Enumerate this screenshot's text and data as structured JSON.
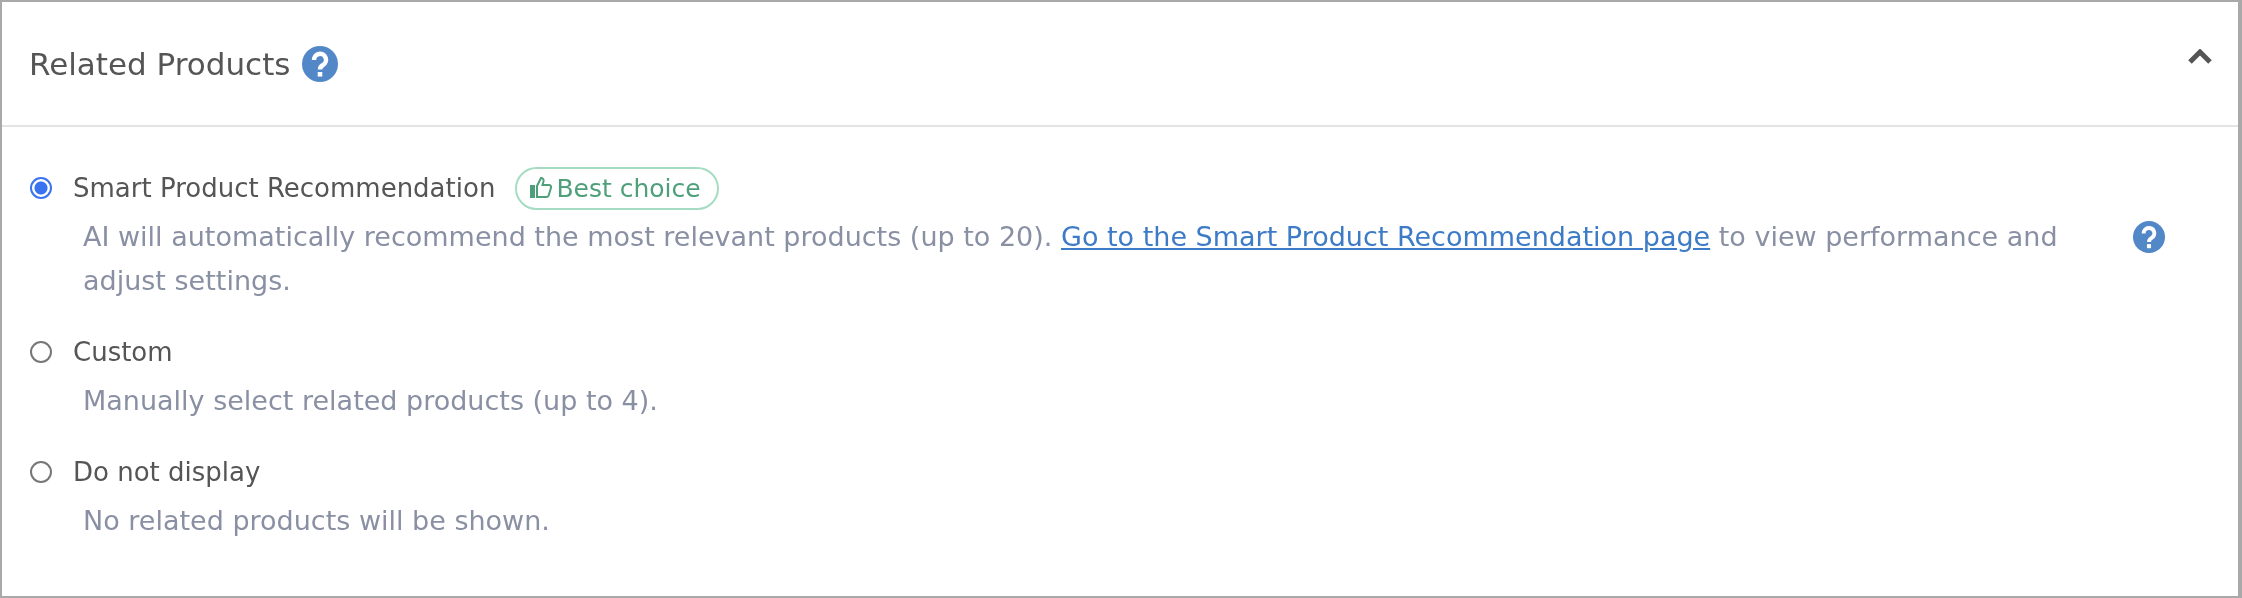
{
  "panel": {
    "title": "Related Products",
    "expanded": true
  },
  "options": [
    {
      "label": "Smart Product Recommendation",
      "selected": true,
      "badge": "Best choice",
      "description": [
        {
          "text": "AI will automatically recommend the most relevant products (up to 20). "
        },
        {
          "text": "Go to the Smart Product Recommendation page",
          "link": true
        },
        {
          "text": " to view performance and adjust settings."
        }
      ],
      "help": true
    },
    {
      "label": "Custom",
      "selected": false,
      "description": [
        {
          "text": "Manually select related products (up to 4)."
        }
      ]
    },
    {
      "label": "Do not display",
      "selected": false,
      "description": [
        {
          "text": "No related products will be shown."
        }
      ]
    }
  ]
}
